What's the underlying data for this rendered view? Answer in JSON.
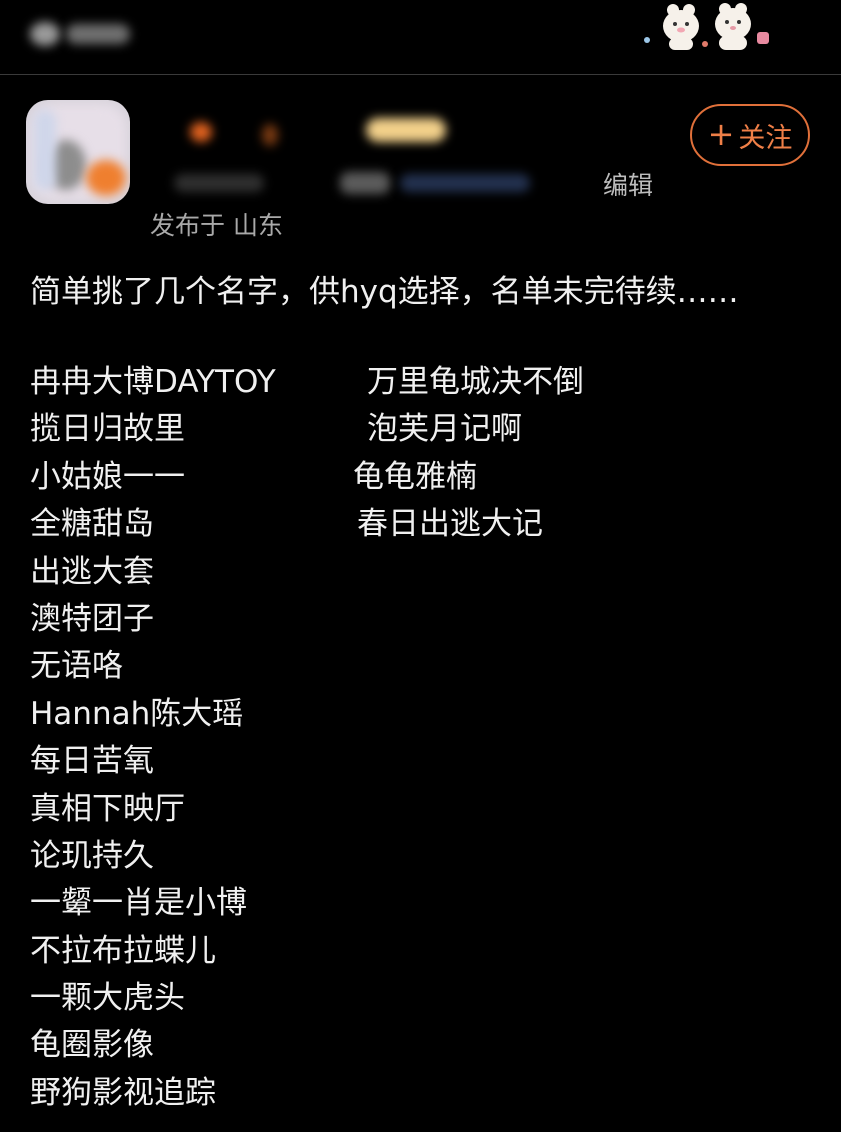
{
  "header": {
    "edit_label": "编辑",
    "location": "发布于 山东",
    "follow_label": "关注",
    "follow_icon": "plus-icon"
  },
  "post": {
    "intro": "简单挑了几个名字，供hyq选择，名单未完待续……",
    "left_names": [
      "冉冉大博DAYTOY",
      "揽日归故里",
      "小姑娘一一",
      "全糖甜岛",
      "出逃大套",
      "澳特团子",
      "无语咯",
      "Hannah陈大瑶",
      "每日苦氧",
      "真相下映厅",
      "论玑持久",
      "一颦一肖是小博",
      "不拉布拉蝶儿",
      "一颗大虎头",
      "龟圈影像",
      "野狗影视追踪"
    ],
    "right_names": [
      "万里龟城决不倒",
      "泡芙月记啊",
      "龟龟雅楠",
      "春日出逃大记"
    ]
  },
  "colors": {
    "background": "#000000",
    "text": "#f0f0f0",
    "follow_accent": "#ef7f47"
  }
}
